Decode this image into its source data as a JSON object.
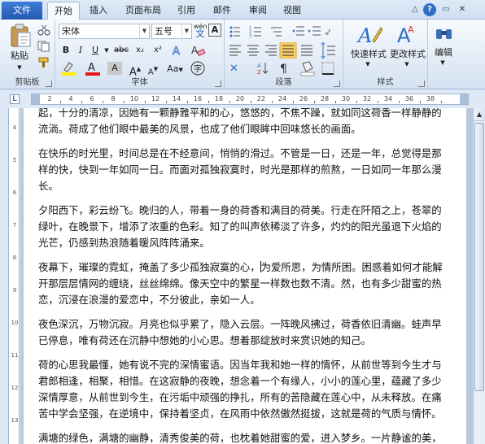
{
  "tabs": {
    "file": "文件",
    "items": [
      {
        "label": "开始",
        "active": true
      },
      {
        "label": "插入"
      },
      {
        "label": "页面布局"
      },
      {
        "label": "引用"
      },
      {
        "label": "邮件"
      },
      {
        "label": "审阅"
      },
      {
        "label": "视图"
      }
    ]
  },
  "window_controls": {
    "help": "?",
    "minimize": "▭",
    "close": "✕",
    "collapse": "△"
  },
  "ribbon": {
    "clipboard": {
      "paste": "粘贴",
      "label": "剪贴板"
    },
    "font": {
      "family": "宋体",
      "size": "五号",
      "wen_label": "wén",
      "bold": "B",
      "italic": "I",
      "underline": "U",
      "strike": "abc",
      "subscript": "x₂",
      "superscript": "x²",
      "grow": "A",
      "shrink": "A",
      "change_case": "Aa",
      "clear": "A",
      "font_color": "A",
      "highlight": "A",
      "char_shade": "A",
      "label": "字体"
    },
    "paragraph": {
      "label": "段落"
    },
    "styles": {
      "quick": "快速样式",
      "change": "更改样式",
      "label": "样式"
    },
    "editing": {
      "label": "编辑"
    }
  },
  "ruler": {
    "numbers": [
      "2",
      "4",
      "6",
      "8",
      "10",
      "12",
      "14",
      "16",
      "18",
      "20",
      "22",
      "24",
      "26",
      "28",
      "30",
      "32",
      "34",
      "36",
      "38"
    ],
    "vnumbers": [
      "4",
      "5",
      "6",
      "7",
      "8",
      "9",
      "10",
      "11",
      "12",
      "13"
    ]
  },
  "document": {
    "paragraphs": [
      {
        "lines": [
          "起，十分的清凉，因她有一颗静雅平和的心，悠悠的，不焦不躁，就如同这荷香一样静静的",
          "流淌。荷成了他们眼中最美的风景，也成了他们眼眸中回味悠长的画面。"
        ]
      },
      {
        "lines": [
          "在快乐的时光里，时间总是在不经意间，悄悄的滑过。不管是一日，还是一年，总觉得是那",
          "样的快，快到一年如同一日。而面对孤独寂寞时，时光是那样的煎熬，一日如同一年那么漫",
          "长。"
        ]
      },
      {
        "lines": [
          "夕阳西下，彩云纷飞。晚归的人，带着一身的荷香和满目的荷美。行走在阡陌之上，苍翠的",
          "绿叶，在晚景下，增添了浓重的色彩。知了的叫声依稀淡了许多，灼灼的阳光虽退下火焰的",
          "光芒，仍感到热浪随着暖风阵阵涌来。"
        ]
      },
      {
        "lines": [
          "夜幕下，璀璨的霓虹，掩盖了多少孤独寂寞的心，为爱所思，为情所困。困惑着如何才能解",
          "开那层层情网的缠绕，丝丝绵绵。像天空中的繁星一样数也数不清。然，也有多少甜蜜的热",
          "恋，沉浸在浪漫的爱恋中，不分彼此，亲如一人。"
        ]
      },
      {
        "lines": [
          "夜色深沉，万物沉寂。月亮也似乎累了，隐入云层。一阵晚风拂过，荷香依旧清幽。蛙声早",
          "已停息，唯有荷还在沉静中想她的小心思。想着那绽放时来赏识她的知己。"
        ]
      },
      {
        "lines": [
          "荷的心思我最懂，她有说不完的深情蜜语。因当年我和她一样的情怀，从前世等到今生才与",
          "君郎相逢，相聚，相惜。在这寂静的夜晚，想念着一个有缘人，小小的莲心里，蕴藏了多少",
          "深情厚意，从前世到今生，在污垢中顽强的挣扎，所有的苦隐藏在莲心中，从未释放。在痛",
          "苦中学会坚强，在逆境中，保持着坚贞，在风雨中依然傲然挺拔，这就是荷的气质与情怀。"
        ]
      },
      {
        "lines": [
          "满塘的绿色，满塘的幽静，清秀俊美的荷，也枕着她甜蜜的爱，进入梦乡。一片静谧的美，"
        ]
      }
    ]
  }
}
